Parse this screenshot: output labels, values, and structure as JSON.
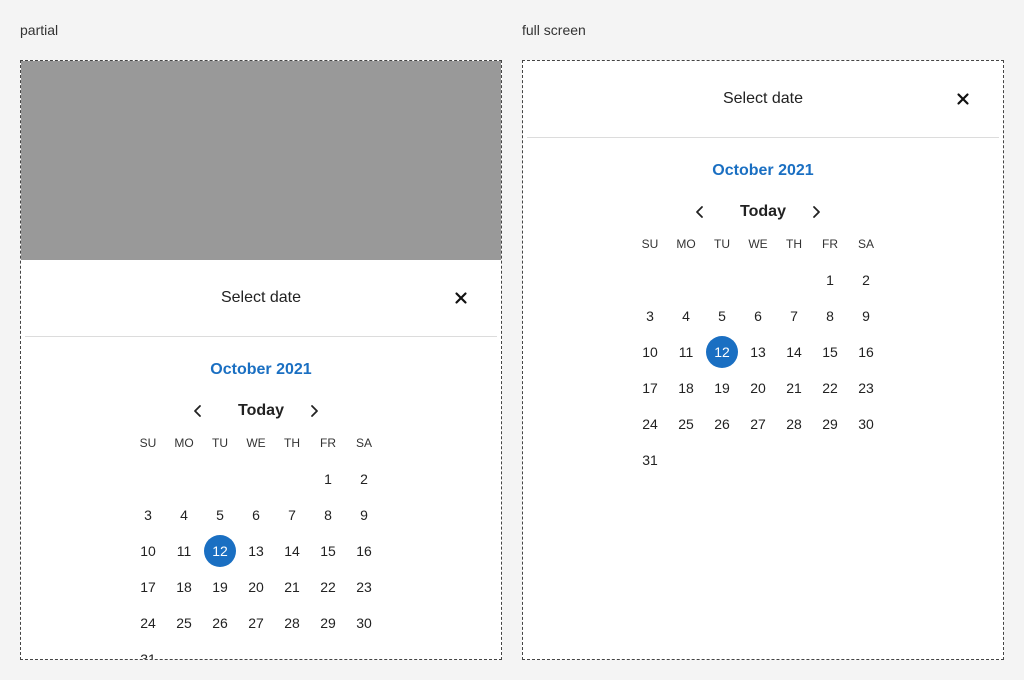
{
  "labels": {
    "partial": "partial",
    "full": "full screen"
  },
  "colors": {
    "accent": "#1a6fc2",
    "scrim": "#999999"
  },
  "dialog": {
    "title": "Select date",
    "close_icon": "close-icon",
    "month": "October 2021",
    "today_label": "Today",
    "prev_icon": "chevron-left-icon",
    "next_icon": "chevron-right-icon",
    "weekdays": [
      "SU",
      "MO",
      "TU",
      "WE",
      "TH",
      "FR",
      "SA"
    ],
    "weeks": [
      [
        "",
        "",
        "",
        "",
        "",
        "1",
        "2"
      ],
      [
        "3",
        "4",
        "5",
        "6",
        "7",
        "8",
        "9"
      ],
      [
        "10",
        "11",
        "12",
        "13",
        "14",
        "15",
        "16"
      ],
      [
        "17",
        "18",
        "19",
        "20",
        "21",
        "22",
        "23"
      ],
      [
        "24",
        "25",
        "26",
        "27",
        "28",
        "29",
        "30"
      ],
      [
        "31",
        "",
        "",
        "",
        "",
        "",
        ""
      ]
    ],
    "selected_day": "12"
  }
}
